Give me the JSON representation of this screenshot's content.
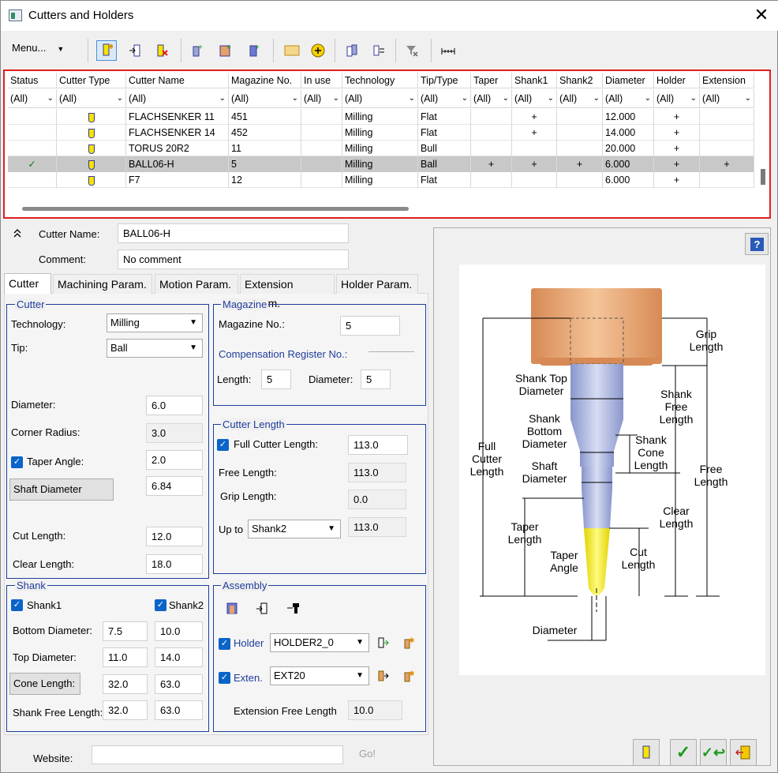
{
  "window": {
    "title": "Cutters and Holders",
    "close_glyph": "✕"
  },
  "toolbar": {
    "menu_label": "Menu...",
    "icons": [
      "new-cutter-icon",
      "import-cutter-icon",
      "delete-cutter-icon",
      "add-shank-icon",
      "add-holder-icon",
      "add-extension-icon",
      "tdm-icon",
      "circle-add-icon",
      "copy-icon",
      "swap-icon",
      "clear-filter-icon",
      "measure-icon"
    ]
  },
  "grid": {
    "columns": [
      "Status",
      "Cutter Type",
      "Cutter Name",
      "Magazine No.",
      "In use",
      "Technology",
      "Tip/Type",
      "Taper",
      "Shank1",
      "Shank2",
      "Diameter",
      "Holder",
      "Extension"
    ],
    "filter_value": "(All)",
    "rows": [
      {
        "status": "",
        "name": "FLACHSENKER 11",
        "mag": "451",
        "inuse": "",
        "tech": "Milling",
        "tip": "Flat",
        "taper": "",
        "shank1": "+",
        "shank2": "",
        "dia": "12.000",
        "holder": "+",
        "ext": "",
        "selected": false
      },
      {
        "status": "",
        "name": "FLACHSENKER 14",
        "mag": "452",
        "inuse": "",
        "tech": "Milling",
        "tip": "Flat",
        "taper": "",
        "shank1": "+",
        "shank2": "",
        "dia": "14.000",
        "holder": "+",
        "ext": "",
        "selected": false
      },
      {
        "status": "",
        "name": "TORUS 20R2",
        "mag": "11",
        "inuse": "",
        "tech": "Milling",
        "tip": "Bull",
        "taper": "",
        "shank1": "",
        "shank2": "",
        "dia": "20.000",
        "holder": "+",
        "ext": "",
        "selected": false
      },
      {
        "status": "✓",
        "name": "BALL06-H",
        "mag": "5",
        "inuse": "",
        "tech": "Milling",
        "tip": "Ball",
        "taper": "+",
        "shank1": "+",
        "shank2": "+",
        "dia": "6.000",
        "holder": "+",
        "ext": "+",
        "selected": true
      },
      {
        "status": "",
        "name": "F7",
        "mag": "12",
        "inuse": "",
        "tech": "Milling",
        "tip": "Flat",
        "taper": "",
        "shank1": "",
        "shank2": "",
        "dia": "6.000",
        "holder": "+",
        "ext": "",
        "selected": false
      }
    ]
  },
  "header_form": {
    "cutter_name_label": "Cutter Name:",
    "cutter_name": "BALL06-H",
    "comment_label": "Comment:",
    "comment": "No comment",
    "collapse_glyph": "»"
  },
  "tabs": [
    "Cutter",
    "Machining Param.",
    "Motion Param.",
    "Extension Param.",
    "Holder Param."
  ],
  "cutter": {
    "title": "Cutter",
    "technology_label": "Technology:",
    "technology": "Milling",
    "tip_label": "Tip:",
    "tip": "Ball",
    "diameter_label": "Diameter:",
    "diameter": "6.0",
    "corner_radius_label": "Corner Radius:",
    "corner_radius": "3.0",
    "taper_angle_label": "Taper Angle:",
    "taper_angle": "2.0",
    "shaft_diameter_label": "Shaft Diameter",
    "shaft_diameter": "6.84",
    "cut_length_label": "Cut Length:",
    "cut_length": "12.0",
    "clear_length_label": "Clear Length:",
    "clear_length": "18.0"
  },
  "magazine": {
    "title": "Magazine",
    "mag_no_label": "Magazine No.:",
    "mag_no": "5",
    "comp_label": "Compensation Register No.:",
    "length_label": "Length:",
    "length": "5",
    "diameter_label": "Diameter:",
    "diameter": "5"
  },
  "cutter_length": {
    "title": "Cutter Length",
    "full_label": "Full Cutter Length:",
    "full": "113.0",
    "free_label": "Free Length:",
    "free": "113.0",
    "grip_label": "Grip Length:",
    "grip": "0.0",
    "upto_label": "Up to",
    "upto": "Shank2",
    "upto_value": "113.0"
  },
  "shank": {
    "title": "Shank",
    "shank1_label": "Shank1",
    "shank2_label": "Shank2",
    "bottom_label": "Bottom Diameter:",
    "bottom1": "7.5",
    "bottom2": "10.0",
    "top_label": "Top Diameter:",
    "top1": "11.0",
    "top2": "14.0",
    "cone_label": "Cone Length:",
    "cone1": "32.0",
    "cone2": "63.0",
    "free_label": "Shank Free Length:",
    "free1": "32.0",
    "free2": "63.0"
  },
  "assembly": {
    "title": "Assembly",
    "holder_label": "Holder",
    "holder": "HOLDER2_0",
    "ext_label": "Exten.",
    "ext": "EXT20",
    "ext_free_label": "Extension Free Length",
    "ext_free": "10.0"
  },
  "footer": {
    "website_label": "Website:",
    "go_label": "Go!"
  },
  "diagram": {
    "help_glyph": "?",
    "labels": {
      "grip": "Grip\nLength",
      "shank_top": "Shank Top\nDiameter",
      "shank_free": "Shank\nFree\nLength",
      "shank_bottom": "Shank\nBottom\nDiameter",
      "shank_cone": "Shank\nCone\nLength",
      "full": "Full\nCutter\nLength",
      "shaft": "Shaft\nDiameter",
      "free": "Free\nLength",
      "clear": "Clear\nLength",
      "taper_len": "Taper\nLength",
      "taper_ang": "Taper\nAngle",
      "cut": "Cut\nLength",
      "diameter": "Diameter"
    }
  },
  "colors": {
    "accent": "#1f3c9b",
    "selection": "#c8c8c8",
    "grid_border": "#e02020",
    "holder": "#e6a06a",
    "shank": "#9aa6d6",
    "tip": "#f2e600"
  }
}
